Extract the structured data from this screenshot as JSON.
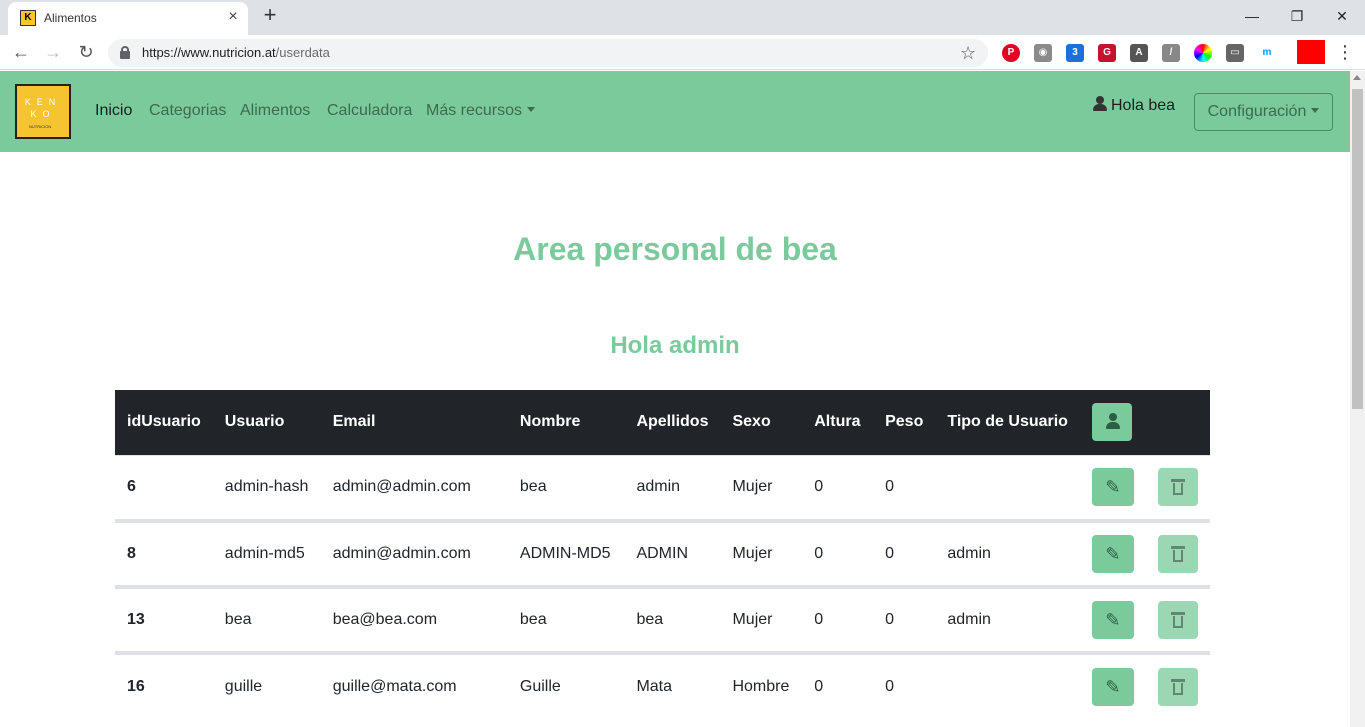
{
  "browser": {
    "tab_title": "Alimentos",
    "tab_favicon_text": "K",
    "url_host": "https://www.nutricion.at",
    "url_path": "/userdata",
    "window_controls": {
      "minimize": "—",
      "restore": "❐",
      "close": "✕"
    }
  },
  "navbar": {
    "brand_text": "KEN KO",
    "brand_sub": "NUTRICION",
    "links": [
      "Inicio",
      "Categorias",
      "Alimentos",
      "Calculadora",
      "Más recursos"
    ],
    "user_greeting": "Hola bea",
    "config_label": "Configuración"
  },
  "page": {
    "title": "Area personal de bea",
    "subtitle": "Hola admin"
  },
  "table": {
    "headers": [
      "idUsuario",
      "Usuario",
      "Email",
      "Nombre",
      "Apellidos",
      "Sexo",
      "Altura",
      "Peso",
      "Tipo de Usuario"
    ],
    "rows": [
      {
        "id": "6",
        "usuario": "admin-hash",
        "email": "admin@admin.com",
        "nombre": "bea",
        "apellidos": "admin",
        "sexo": "Mujer",
        "altura": "0",
        "peso": "0",
        "tipo": ""
      },
      {
        "id": "8",
        "usuario": "admin-md5",
        "email": "admin@admin.com",
        "nombre": "ADMIN-MD5",
        "apellidos": "ADMIN",
        "sexo": "Mujer",
        "altura": "0",
        "peso": "0",
        "tipo": "admin"
      },
      {
        "id": "13",
        "usuario": "bea",
        "email": "bea@bea.com",
        "nombre": "bea",
        "apellidos": "bea",
        "sexo": "Mujer",
        "altura": "0",
        "peso": "0",
        "tipo": "admin"
      },
      {
        "id": "16",
        "usuario": "guille",
        "email": "guille@mata.com",
        "nombre": "Guille",
        "apellidos": "Mata",
        "sexo": "Hombre",
        "altura": "0",
        "peso": "0",
        "tipo": ""
      }
    ]
  },
  "colors": {
    "accent": "#7bca9c",
    "table_header_bg": "#212529",
    "icon_dark": "#2d5e44"
  }
}
